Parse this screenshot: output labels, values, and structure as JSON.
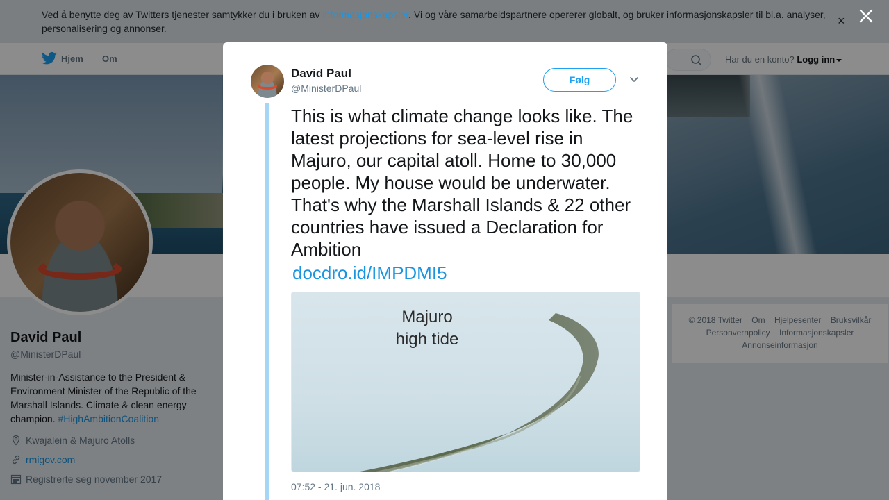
{
  "cookie_banner": {
    "text_before": "Ved å benytte deg av Twitters tjenester samtykker du i bruken av ",
    "link": "informasjonskapsler",
    "text_after": ". Vi og våre samarbeidspartnere opererer globalt, og bruker informasjonskapsler til bl.a. analyser, personalisering og annonser.",
    "close": "×"
  },
  "nav": {
    "home": "Hjem",
    "about": "Om",
    "login_prompt": "Har du en konto?",
    "login": "Logg inn"
  },
  "profile": {
    "name": "David Paul",
    "handle": "@MinisterDPaul",
    "bio": "Minister-in-Assistance to the President & Environment Minister of the Republic of the Marshall Islands. Climate & clean energy champion.",
    "bio_tag": "#HighAmbitionCoalition",
    "location": "Kwajalein & Majuro Atolls",
    "website": "rmigov.com",
    "joined": "Registrerte seg november 2017"
  },
  "footer": {
    "row1": [
      "© 2018 Twitter",
      "Om",
      "Hjelpesenter",
      "Bruksvilkår"
    ],
    "row2": [
      "Personvernpolicy",
      "Informasjonskapsler"
    ],
    "row3": [
      "Annonseinformasjon"
    ]
  },
  "tweet": {
    "name": "David Paul",
    "handle": "@MinisterDPaul",
    "follow_label": "Følg",
    "text": "This is what climate change looks like. The latest projections for sea-level rise in Majuro, our capital atoll. Home to 30,000 people. My house would be underwater. That's why the Marshall Islands & 22 other countries have issued a Declaration for Ambition",
    "link": "docdro.id/IMPDMI5",
    "media_title": "Majuro high tide",
    "timestamp": "07:52 - 21. jun. 2018"
  },
  "colors": {
    "link": "#1b95e0",
    "follow_border": "#1da1f2",
    "thread_line": "#a6d6f5"
  }
}
